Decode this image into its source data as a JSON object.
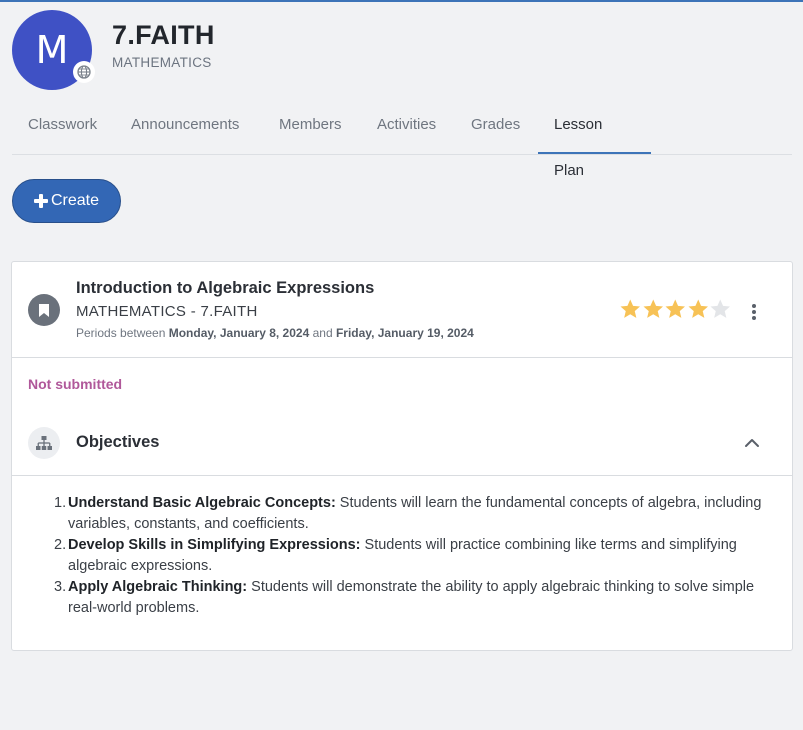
{
  "header": {
    "avatar_letter": "M",
    "class_name": "7.FAITH",
    "subject": "MATHEMATICS"
  },
  "tabs": [
    {
      "label": "Classwork",
      "active": false
    },
    {
      "label": "Announcements",
      "active": false
    },
    {
      "label": "Members",
      "active": false
    },
    {
      "label": "Activities",
      "active": false
    },
    {
      "label": "Grades",
      "active": false
    },
    {
      "label": "Lesson Plan",
      "active": true
    }
  ],
  "create_button": {
    "label": "Create"
  },
  "lesson": {
    "title": "Introduction to Algebraic Expressions",
    "subtitle": "MATHEMATICS - 7.FAITH",
    "period_prefix": "Periods between",
    "start_date": "Monday, January 8, 2024",
    "period_joiner": "and",
    "end_date": "Friday, January 19, 2024",
    "rating": 4,
    "rating_max": 5,
    "status": "Not submitted"
  },
  "objectives": {
    "title": "Objectives",
    "items": [
      {
        "num": "1.",
        "heading": "Understand Basic Algebraic Concepts:",
        "text": " Students will learn the fundamental concepts of algebra, including variables, constants, and coefficients."
      },
      {
        "num": "2.",
        "heading": "Develop Skills in Simplifying Expressions:",
        "text": " Students will practice combining like terms and simplifying algebraic expressions."
      },
      {
        "num": "3.",
        "heading": "Apply Algebraic Thinking:",
        "text": " Students will demonstrate the ability to apply algebraic thinking to solve simple real-world problems."
      }
    ]
  },
  "colors": {
    "accent": "#3d74b8",
    "avatar_bg": "#3f51c5",
    "star_filled": "#f7c256",
    "star_empty": "#e3e5e8",
    "status": "#b0589a"
  },
  "icons": {
    "avatar_badge": "globe-icon",
    "create": "plus-icon",
    "lesson": "bookmark-icon",
    "rating": "star-icon",
    "menu": "more-vertical-icon",
    "objectives": "sitemap-icon",
    "collapse": "chevron-up-icon"
  }
}
